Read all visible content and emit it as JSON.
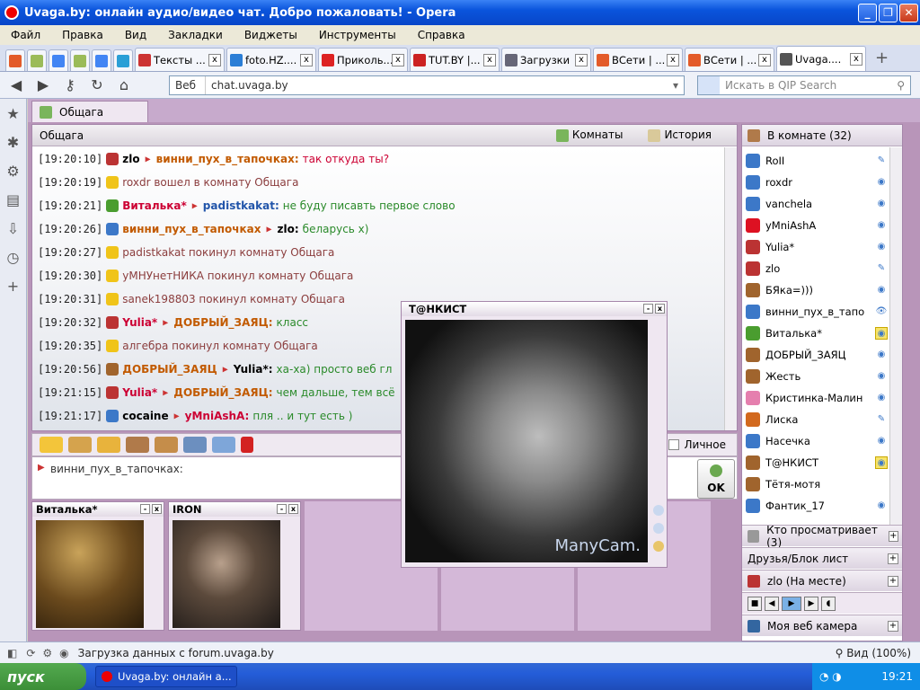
{
  "window": {
    "title": "Uvaga.by: онлайн аудио/видео чат. Добро пожаловать! - Opera"
  },
  "menu": [
    "Файл",
    "Правка",
    "Вид",
    "Закладки",
    "Виджеты",
    "Инструменты",
    "Справка"
  ],
  "tabs": [
    {
      "label": "Тексты ..."
    },
    {
      "label": "foto.HZ...."
    },
    {
      "label": "Приколь..."
    },
    {
      "label": "TUT.BY |..."
    },
    {
      "label": "Загрузки"
    },
    {
      "label": "ВСети | ..."
    },
    {
      "label": "ВСети | ..."
    },
    {
      "label": "Uvaga...."
    }
  ],
  "address": {
    "prefix": "Веб",
    "url": "chat.uvaga.by"
  },
  "search": {
    "placeholder": "Искать в QIP Search"
  },
  "room_tab": "Общага",
  "chat": {
    "header": "Общага",
    "rooms_label": "Комнаты",
    "history_label": "История",
    "messages": [
      {
        "time": "[19:20:10]",
        "from": "zlo",
        "to": "винни_пух_в_тапочках",
        "text": "так откуда ты?",
        "icon": "guitar-icon"
      },
      {
        "time": "[19:20:19]",
        "sys": "roxdr вошел в комнату Общага",
        "icon": "warning-icon"
      },
      {
        "time": "[19:20:21]",
        "from": "Виталька*",
        "to": "padistkakat",
        "text": "не буду писавть первое слово",
        "icon": "badge-icon"
      },
      {
        "time": "[19:20:26]",
        "from": "винни_пух_в_тапочках",
        "to": "zlo",
        "text": "беларусь х)",
        "icon": "user-icon"
      },
      {
        "time": "[19:20:27]",
        "sys": "padistkakat покинул комнату Общага",
        "icon": "warning-icon"
      },
      {
        "time": "[19:20:30]",
        "sys": "уМНУнетНИКА покинул комнату Общага",
        "icon": "warning-icon"
      },
      {
        "time": "[19:20:31]",
        "sys": "sanek198803 покинул комнату Общага",
        "icon": "warning-icon"
      },
      {
        "time": "[19:20:32]",
        "from": "Yulia*",
        "to": "ДОБРЫЙ_ЗАЯЦ",
        "text": "класс",
        "icon": "guitar-icon"
      },
      {
        "time": "[19:20:35]",
        "sys": "алгебра покинул комнату Общага",
        "icon": "warning-icon"
      },
      {
        "time": "[19:20:56]",
        "from": "ДОБРЫЙ_ЗАЯЦ",
        "to": "Yulia*",
        "text": "ха-ха) просто веб гл",
        "icon": "bear-icon"
      },
      {
        "time": "[19:21:15]",
        "from": "Yulia*",
        "to": "ДОБРЫЙ_ЗАЯЦ",
        "text": "чем дальше, тем всё",
        "icon": "guitar-icon"
      },
      {
        "time": "[19:21:17]",
        "from": "cocaine",
        "to": "yMniAshA",
        "text": "пля .. и тут есть )",
        "icon": "cup-icon"
      }
    ],
    "private_label": "Личное",
    "input_value": "винни_пух_в_тапочках:",
    "ok_label": "OK"
  },
  "cams": [
    {
      "title": "Виталька*"
    },
    {
      "title": "IRON"
    }
  ],
  "tank_window": {
    "title": "T@НКИСТ",
    "watermark": "ManyCam."
  },
  "room_panel": {
    "title": "В комнате (32)",
    "users": [
      {
        "name": "RoII",
        "icon": "user-icon",
        "status": "pencil"
      },
      {
        "name": "roxdr",
        "icon": "user-icon",
        "status": "cam"
      },
      {
        "name": "vanchela",
        "icon": "user-icon",
        "status": "cam"
      },
      {
        "name": "yMniAshA",
        "icon": "heart-icon",
        "status": "cam"
      },
      {
        "name": "Yulia*",
        "icon": "guitar-icon",
        "status": "cam"
      },
      {
        "name": "zlo",
        "icon": "guitar-icon",
        "status": "pencil"
      },
      {
        "name": "БЯка=)))",
        "icon": "bear-icon",
        "status": "cam"
      },
      {
        "name": "винни_пух_в_тапо",
        "icon": "user-icon",
        "status": "eye"
      },
      {
        "name": "Виталька*",
        "icon": "badge-icon",
        "status": "cam-hl"
      },
      {
        "name": "ДОБРЫЙ_ЗАЯЦ",
        "icon": "bear-icon",
        "status": "cam"
      },
      {
        "name": "Жесть",
        "icon": "bear-icon",
        "status": "cam"
      },
      {
        "name": "Кристинка-Малин",
        "icon": "pig-icon",
        "status": "cam"
      },
      {
        "name": "Лиска",
        "icon": "fox-icon",
        "status": "pencil"
      },
      {
        "name": "Насечка",
        "icon": "user-icon",
        "status": "cam"
      },
      {
        "name": "T@НКИСТ",
        "icon": "bear-icon",
        "status": "eye-cam-hl"
      },
      {
        "name": "Тётя-мотя",
        "icon": "bear-icon",
        "status": ""
      },
      {
        "name": "Фантик_17",
        "icon": "user-icon",
        "status": "cam"
      }
    ],
    "sections": [
      "Кто просматривает (3)",
      "Друзья/Блок лист",
      "zlo (На месте)",
      "Моя веб камера"
    ]
  },
  "status": {
    "loading": "Загрузка данных с forum.uvaga.by",
    "zoom": "Вид (100%)"
  },
  "taskbar": {
    "start": "пуск",
    "task": "Uvaga.by: онлайн а...",
    "lang": "RU",
    "clock": "19:21"
  }
}
